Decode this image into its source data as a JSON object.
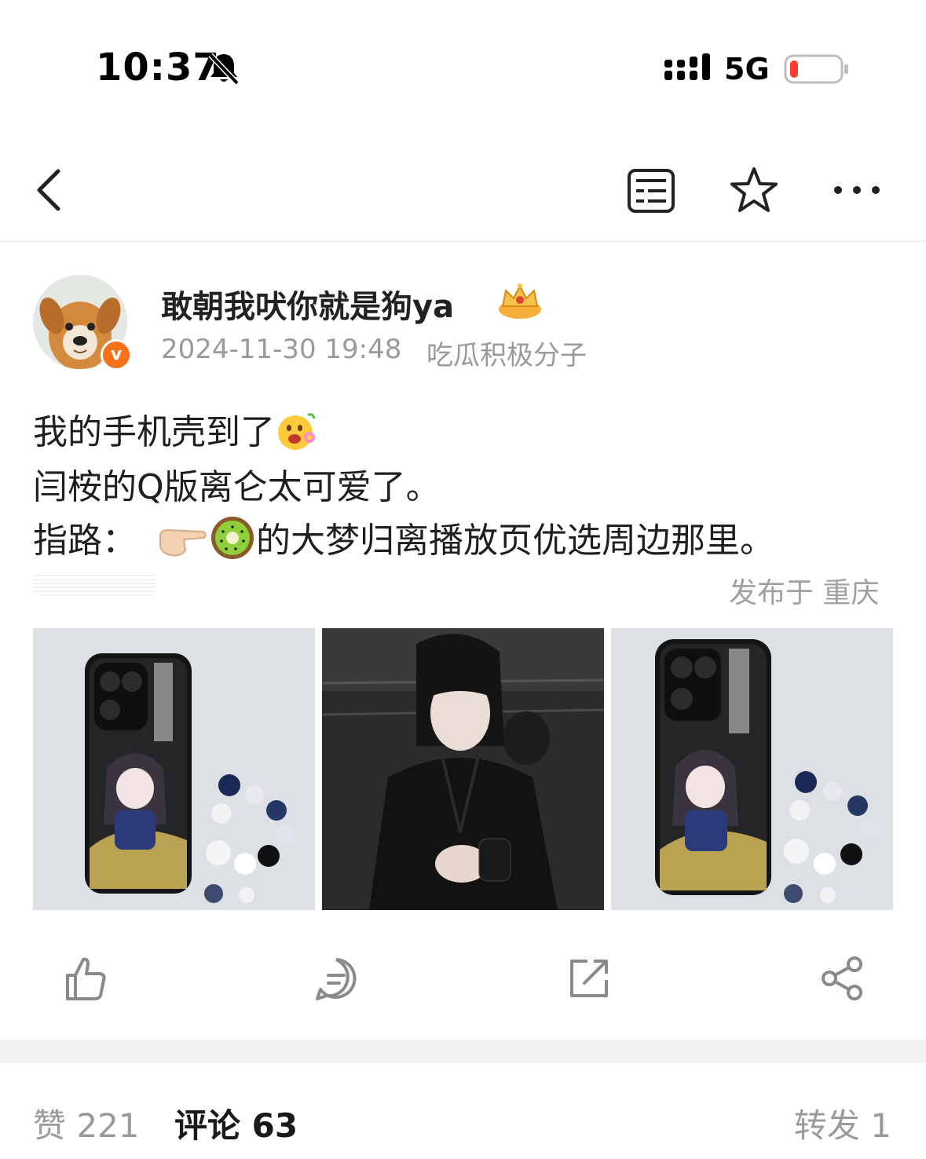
{
  "status_bar": {
    "time": "10:37",
    "network": "5G",
    "battery_level": 0.08,
    "battery_color": "#ff3b30",
    "icons": [
      "bell-slash-icon",
      "signal-icon",
      "battery-icon"
    ]
  },
  "nav": {
    "icons": [
      "back-chevron-icon",
      "list-icon",
      "star-icon",
      "more-icon"
    ]
  },
  "author": {
    "name": "敢朝我吠你就是狗ya",
    "verified_badge": "v",
    "timestamp": "2024-11-30 19:48",
    "tag": "吃瓜积极分子"
  },
  "content": {
    "line1": "我的手机壳到了",
    "line2": "闫桉的Q版离仑太可爱了。",
    "line3_prefix": "指路：",
    "line3_suffix": "的大梦归离播放页优选周边那里。",
    "emojis": [
      "happy-flower-emoji",
      "pointing-hand-emoji",
      "kiwi-emoji"
    ],
    "location": "发布于 重庆"
  },
  "images": [
    {
      "name": "phone-case-photo"
    },
    {
      "name": "actor-photo"
    },
    {
      "name": "phone-case-photo"
    }
  ],
  "actions": [
    "like-icon",
    "comment-icon",
    "repost-icon",
    "share-icon"
  ],
  "tabs": {
    "like": "赞 221",
    "comment": "评论 63",
    "repost": "转发 1"
  },
  "colors": {
    "accent_orange": "#f7711b",
    "text_gray": "#9a9a9a"
  }
}
